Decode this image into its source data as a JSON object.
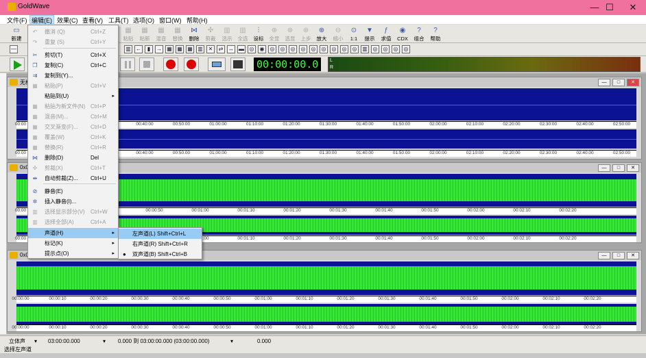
{
  "window": {
    "title": "GoldWave",
    "minimize": "—",
    "maximize": "☐",
    "close": "✕"
  },
  "menubar": [
    "文件(F)",
    "编辑(E)",
    "效果(C)",
    "查看(V)",
    "工具(T)",
    "选项(O)",
    "窗口(W)",
    "帮助(H)"
  ],
  "toolbar": [
    "新建",
    "撤消",
    "粘贴",
    "粘新",
    "混音",
    "替换",
    "删除",
    "剪裁",
    "选示",
    "全选",
    "设标",
    "全显",
    "选显",
    "上步",
    "放大",
    "缩小",
    "1:1",
    "提示",
    "求值",
    "CDX",
    "组合",
    "帮助"
  ],
  "time_display": "00:00:00.0",
  "vu_labels": [
    "L",
    "R"
  ],
  "edit_menu": [
    {
      "label": "撤消 (Q)",
      "shortcut": "Ctrl+Z",
      "enabled": false,
      "icon": "undo-icon"
    },
    {
      "label": "重复 (S)",
      "shortcut": "Ctrl+Y",
      "enabled": false,
      "icon": "redo-icon"
    },
    {
      "label": "剪切(T)",
      "shortcut": "Ctrl+X",
      "enabled": true,
      "icon": "cut-icon"
    },
    {
      "label": "复制(C)",
      "shortcut": "Ctrl+C",
      "enabled": true,
      "icon": "copy-icon"
    },
    {
      "label": "复制到(Y)...",
      "shortcut": "",
      "enabled": true,
      "icon": "copy-to-icon"
    },
    {
      "label": "粘贴(P)",
      "shortcut": "Ctrl+V",
      "enabled": false,
      "icon": "paste-icon"
    },
    {
      "label": "粘贴到(U)",
      "shortcut": "",
      "enabled": true,
      "icon": "",
      "submenu": true
    },
    {
      "label": "粘贴为新文件(N)",
      "shortcut": "Ctrl+P",
      "enabled": false,
      "icon": "paste-new-icon"
    },
    {
      "label": "混音(M)...",
      "shortcut": "Ctrl+M",
      "enabled": false,
      "icon": "mix-icon"
    },
    {
      "label": "交叉渐变(F)...",
      "shortcut": "Ctrl+D",
      "enabled": false,
      "icon": "crossfade-icon"
    },
    {
      "label": "覆盖(W)",
      "shortcut": "Ctrl+K",
      "enabled": false,
      "icon": "overwrite-icon"
    },
    {
      "label": "替换(R)",
      "shortcut": "Ctrl+R",
      "enabled": false,
      "icon": "replace-icon"
    },
    {
      "label": "删除(D)",
      "shortcut": "Del",
      "enabled": true,
      "icon": "delete-icon"
    },
    {
      "label": "剪裁(X)",
      "shortcut": "Ctrl+T",
      "enabled": false,
      "icon": "trim-icon"
    },
    {
      "label": "自动剪裁(Z)...",
      "shortcut": "Ctrl+U",
      "enabled": true,
      "icon": "auto-trim-icon"
    },
    {
      "label": "静音(E)",
      "shortcut": "",
      "enabled": true,
      "icon": "silence-icon"
    },
    {
      "label": "插入静音(I)...",
      "shortcut": "",
      "enabled": true,
      "icon": "insert-silence-icon"
    },
    {
      "label": "选择显示部分(V)",
      "shortcut": "Ctrl+W",
      "enabled": false,
      "icon": "select-view-icon"
    },
    {
      "label": "选择全部(A)",
      "shortcut": "Ctrl+A",
      "enabled": false,
      "icon": "select-all-icon"
    },
    {
      "label": "声道(H)",
      "shortcut": "",
      "enabled": true,
      "icon": "",
      "submenu": true
    },
    {
      "label": "标记(K)",
      "shortcut": "",
      "enabled": true,
      "icon": "",
      "submenu": true
    },
    {
      "label": "提示点(O)",
      "shortcut": "",
      "enabled": true,
      "icon": "",
      "submenu": true
    }
  ],
  "channel_submenu": [
    {
      "label": "左声道(L)   Shift+Ctrl+L"
    },
    {
      "label": "右声道(R)   Shift+Ctrl+R"
    },
    {
      "label": "双声道(B)   Shift+Ctrl+B"
    }
  ],
  "documents": [
    {
      "title": "无标题"
    },
    {
      "title": "0x0"
    },
    {
      "title": "0x0"
    }
  ],
  "ruler_top": [
    "00:00",
    "00:30:00",
    "00:40:00",
    "00:50:00",
    "01:00:00",
    "01:10:00",
    "01:20:00",
    "01:30:00",
    "01:40:00",
    "01:50:00",
    "02:00:00",
    "02:10:00",
    "02:20:00",
    "02:30:00",
    "02:40:00",
    "02:50:00"
  ],
  "ruler_audio": [
    "00:00",
    "00:00:30",
    "00:00:40",
    "00:00:50",
    "00:01:00",
    "00:01:10",
    "00:01:20",
    "00:01:30",
    "00:01:40",
    "00:01:50",
    "00:02:00",
    "00:02:10",
    "00:02:20"
  ],
  "ruler_audio_full": [
    "00:00:00",
    "00:00:10",
    "00:00:20",
    "00:00:30",
    "00:00:40",
    "00:00:50",
    "00:01:00",
    "00:01:10",
    "00:01:20",
    "00:01:30",
    "00:01:40",
    "00:01:50",
    "00:02:00",
    "00:02:10",
    "00:02:20"
  ],
  "status": {
    "mode": "立体声",
    "length": "03:00:00.000",
    "selection": "0.000 到 03:00:00.000 (03:00:00.000)",
    "value": "0.000",
    "hint": "选择左声道"
  },
  "colors": {
    "title_bar": "#f0719e",
    "waveform_bg": "#0b1294",
    "waveform": "#3bff3b",
    "time_display": "#3cff3c"
  }
}
